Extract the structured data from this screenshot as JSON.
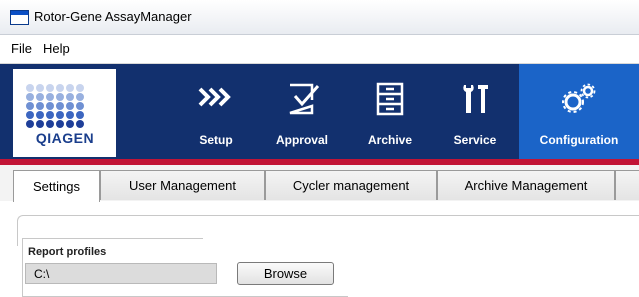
{
  "window": {
    "title": "Rotor-Gene AssayManager"
  },
  "menu": {
    "items": [
      "File",
      "Help"
    ]
  },
  "logo": {
    "brand": "QIAGEN",
    "dot_colors": [
      "#c8d4ee",
      "#98b0df",
      "#6f90d3",
      "#3c66c0",
      "#1f3f99"
    ]
  },
  "toolbar": {
    "buttons": [
      {
        "label": "Setup",
        "icon": "chevrons-right-icon"
      },
      {
        "label": "Approval",
        "icon": "approval-check-icon"
      },
      {
        "label": "Archive",
        "icon": "archive-icon"
      },
      {
        "label": "Service",
        "icon": "tools-icon"
      },
      {
        "label": "Configuration",
        "icon": "gears-icon",
        "active": true
      }
    ],
    "colors": {
      "background": "#12306e",
      "active": "#1b64c8",
      "accent_line": "#c21436"
    }
  },
  "tabs": [
    {
      "label": "Settings",
      "active": true
    },
    {
      "label": "User Management"
    },
    {
      "label": "Cycler management"
    },
    {
      "label": "Archive Management"
    }
  ],
  "report_profiles": {
    "label": "Report profiles",
    "path_value": "C:\\",
    "browse_label": "Browse"
  }
}
